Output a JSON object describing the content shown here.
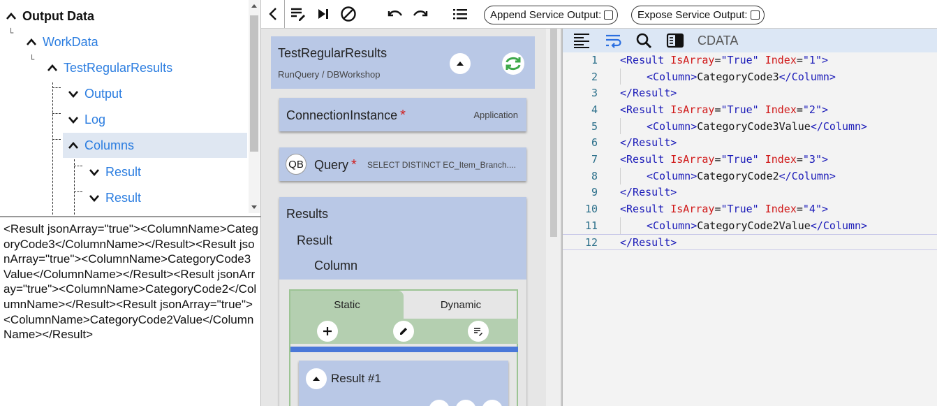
{
  "tree": {
    "nodes": [
      {
        "label": "Output Data",
        "chevron": "up"
      },
      {
        "label": "WorkData",
        "chevron": "up"
      },
      {
        "label": "TestRegularResults",
        "chevron": "up"
      },
      {
        "label": "Output",
        "chevron": "down"
      },
      {
        "label": "Log",
        "chevron": "down"
      },
      {
        "label": "Columns",
        "chevron": "up",
        "selected": true
      },
      {
        "label": "Result",
        "chevron": "down"
      },
      {
        "label": "Result",
        "chevron": "down"
      }
    ]
  },
  "xml_preview": "<Result jsonArray=\"true\"><ColumnName>CategoryCode3</ColumnName></Result><Result jsonArray=\"true\"><ColumnName>CategoryCode3Value</ColumnName></Result><Result jsonArray=\"true\"><ColumnName>CategoryCode2</ColumnName></Result><Result jsonArray=\"true\"><ColumnName>CategoryCode2Value</ColumnName></Result>",
  "toolbar": {
    "append_label": "Append Service Output:",
    "expose_label": "Expose Service Output:"
  },
  "service": {
    "title": "TestRegularResults",
    "subtitle": "RunQuery / DBWorkshop",
    "connection": {
      "label": "ConnectionInstance",
      "required_mark": "*",
      "value": "Application"
    },
    "query": {
      "badge": "QB",
      "label": "Query",
      "required_mark": "*",
      "value": "SELECT DISTINCT EC_Item_Branch...."
    },
    "results": {
      "title": "Results",
      "child": "Result",
      "grandchild": "Column",
      "tabs": {
        "static": "Static",
        "dynamic": "Dynamic"
      },
      "item_title": "Result #1"
    }
  },
  "editor": {
    "cdata_label": "CDATA",
    "lines": [
      {
        "n": "1",
        "indent": 0,
        "tokens": [
          {
            "t": "tag",
            "v": "<Result "
          },
          {
            "t": "attr",
            "v": "IsArray"
          },
          {
            "t": "text",
            "v": "="
          },
          {
            "t": "val",
            "v": "\"True\" "
          },
          {
            "t": "attr",
            "v": "Index"
          },
          {
            "t": "text",
            "v": "="
          },
          {
            "t": "val",
            "v": "\"1\">"
          }
        ]
      },
      {
        "n": "2",
        "indent": 1,
        "tokens": [
          {
            "t": "tag",
            "v": "<Column>"
          },
          {
            "t": "text",
            "v": "CategoryCode3"
          },
          {
            "t": "tag",
            "v": "</Column>"
          }
        ]
      },
      {
        "n": "3",
        "indent": 0,
        "tokens": [
          {
            "t": "tag",
            "v": "</Result>"
          }
        ]
      },
      {
        "n": "4",
        "indent": 0,
        "tokens": [
          {
            "t": "tag",
            "v": "<Result "
          },
          {
            "t": "attr",
            "v": "IsArray"
          },
          {
            "t": "text",
            "v": "="
          },
          {
            "t": "val",
            "v": "\"True\" "
          },
          {
            "t": "attr",
            "v": "Index"
          },
          {
            "t": "text",
            "v": "="
          },
          {
            "t": "val",
            "v": "\"2\">"
          }
        ]
      },
      {
        "n": "5",
        "indent": 1,
        "tokens": [
          {
            "t": "tag",
            "v": "<Column>"
          },
          {
            "t": "text",
            "v": "CategoryCode3Value"
          },
          {
            "t": "tag",
            "v": "</Column>"
          }
        ]
      },
      {
        "n": "6",
        "indent": 0,
        "tokens": [
          {
            "t": "tag",
            "v": "</Result>"
          }
        ]
      },
      {
        "n": "7",
        "indent": 0,
        "tokens": [
          {
            "t": "tag",
            "v": "<Result "
          },
          {
            "t": "attr",
            "v": "IsArray"
          },
          {
            "t": "text",
            "v": "="
          },
          {
            "t": "val",
            "v": "\"True\" "
          },
          {
            "t": "attr",
            "v": "Index"
          },
          {
            "t": "text",
            "v": "="
          },
          {
            "t": "val",
            "v": "\"3\">"
          }
        ]
      },
      {
        "n": "8",
        "indent": 1,
        "tokens": [
          {
            "t": "tag",
            "v": "<Column>"
          },
          {
            "t": "text",
            "v": "CategoryCode2"
          },
          {
            "t": "tag",
            "v": "</Column>"
          }
        ]
      },
      {
        "n": "9",
        "indent": 0,
        "tokens": [
          {
            "t": "tag",
            "v": "</Result>"
          }
        ]
      },
      {
        "n": "10",
        "indent": 0,
        "tokens": [
          {
            "t": "tag",
            "v": "<Result "
          },
          {
            "t": "attr",
            "v": "IsArray"
          },
          {
            "t": "text",
            "v": "="
          },
          {
            "t": "val",
            "v": "\"True\" "
          },
          {
            "t": "attr",
            "v": "Index"
          },
          {
            "t": "text",
            "v": "="
          },
          {
            "t": "val",
            "v": "\"4\">"
          }
        ]
      },
      {
        "n": "11",
        "indent": 1,
        "tokens": [
          {
            "t": "tag",
            "v": "<Column>"
          },
          {
            "t": "text",
            "v": "CategoryCode2Value"
          },
          {
            "t": "tag",
            "v": "</Column>"
          }
        ]
      },
      {
        "n": "12",
        "indent": 0,
        "tokens": [
          {
            "t": "tag",
            "v": "</Result>"
          }
        ]
      }
    ]
  },
  "colors": {
    "accent_blue": "#2b7de0",
    "card_blue": "#b9c8e6",
    "tab_green": "#b4cfb0",
    "selection_bar": "#4a78d8",
    "editor_header": "#dce7f5"
  }
}
